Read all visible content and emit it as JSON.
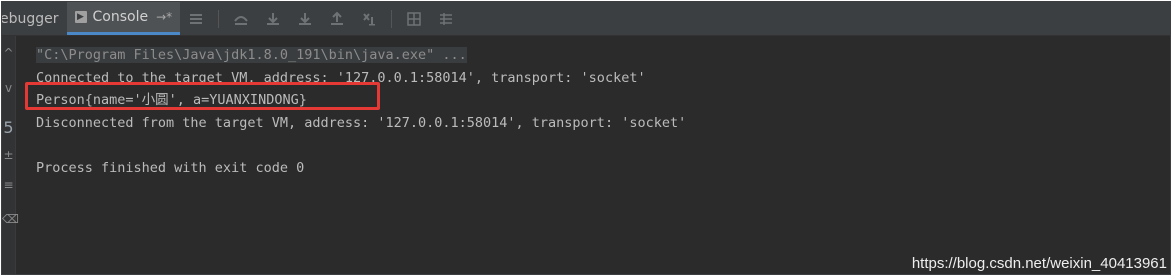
{
  "toolbar": {
    "debugger_tab": "ebugger",
    "console_tab": "Console",
    "pin_glyph": "→*"
  },
  "console_lines": [
    "\"C:\\Program Files\\Java\\jdk1.8.0_191\\bin\\java.exe\" ...",
    "Connected to the target VM, address: '127.0.0.1:58014', transport: 'socket'",
    "Person{name='小圆', a=YUANXINDONG}",
    "Disconnected from the target VM, address: '127.0.0.1:58014', transport: 'socket'",
    "",
    "Process finished with exit code 0"
  ],
  "watermark": "https://blog.csdn.net/weixin_40413961",
  "colors": {
    "console_bg": "#2b2b2b",
    "toolbar_bg": "#3c3f41",
    "text": "#bbbbbb",
    "highlight_box": "#e53935"
  },
  "icons": [
    "console-icon",
    "pin-icon",
    "menu-icon",
    "step-over-icon",
    "step-into-icon",
    "force-step-into-icon",
    "step-out-icon",
    "run-to-cursor-icon",
    "evaluate-icon",
    "trace-icon"
  ]
}
